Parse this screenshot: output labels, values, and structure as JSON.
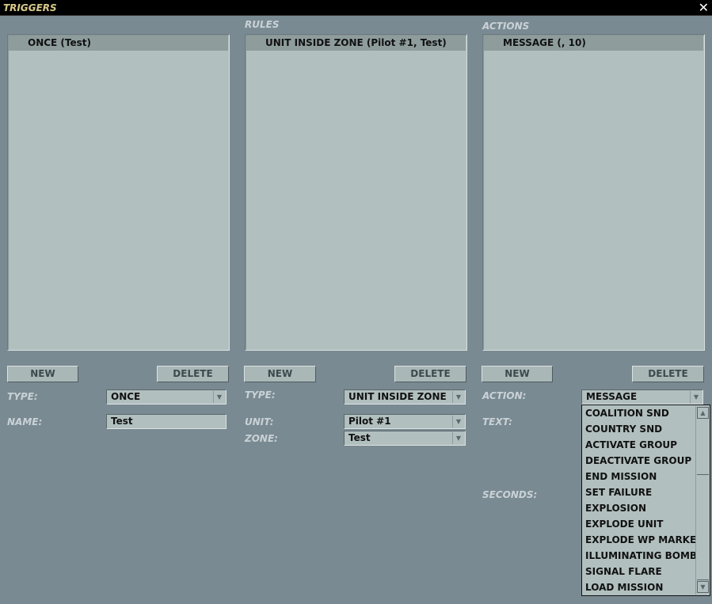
{
  "window": {
    "title": "TRIGGERS",
    "close_glyph": "✕"
  },
  "triggers": {
    "items": [
      "ONCE (Test)"
    ],
    "new_label": "NEW",
    "delete_label": "DELETE",
    "type_label": "TYPE:",
    "type_value": "ONCE",
    "name_label": "NAME:",
    "name_value": "Test"
  },
  "rules": {
    "heading": "RULES",
    "items": [
      "UNIT INSIDE ZONE (Pilot #1, Test)"
    ],
    "new_label": "NEW",
    "delete_label": "DELETE",
    "type_label": "TYPE:",
    "type_value": "UNIT INSIDE ZONE",
    "unit_label": "UNIT:",
    "unit_value": "Pilot #1",
    "zone_label": "ZONE:",
    "zone_value": "Test"
  },
  "actions": {
    "heading": "ACTIONS",
    "items": [
      "MESSAGE (, 10)"
    ],
    "new_label": "NEW",
    "delete_label": "DELETE",
    "action_label": "ACTION:",
    "action_value": "MESSAGE",
    "text_label": "TEXT:",
    "seconds_label": "SECONDS:",
    "dropdown_options": [
      "COALITION SND",
      "COUNTRY SND",
      "ACTIVATE GROUP",
      "DEACTIVATE GROUP",
      "END MISSION",
      "SET FAILURE",
      "EXPLOSION",
      "EXPLODE UNIT",
      "EXPLODE WP MARKER",
      "ILLUMINATING BOMB",
      "SIGNAL FLARE",
      "LOAD MISSION"
    ]
  },
  "icons": {
    "combo_arrow": "▼",
    "scroll_up": "▲",
    "scroll_down": "▼"
  },
  "colors": {
    "background": "#7a8a92",
    "panel": "#b2bfbf",
    "selected_row": "#8e9c9c",
    "title_text": "#d9c98a",
    "label_text": "#c9d2d6"
  }
}
